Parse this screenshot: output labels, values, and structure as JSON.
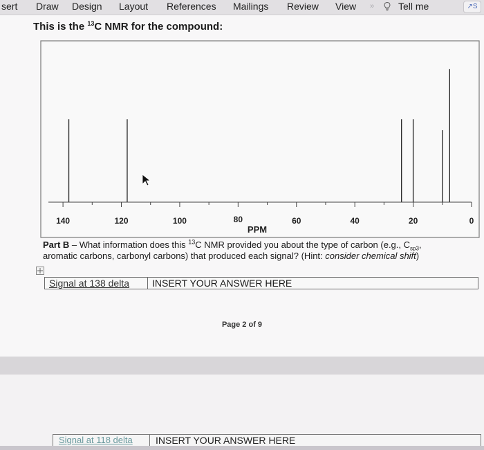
{
  "ribbon": {
    "tabs": [
      "sert",
      "Draw",
      "Design",
      "Layout",
      "References",
      "Mailings",
      "Review",
      "View"
    ],
    "tell_me": "Tell me",
    "more_symbol": "»",
    "share_label": "S"
  },
  "document": {
    "heading_pre": "This is the ",
    "heading_sup": "13",
    "heading_post": "C NMR for the compound:",
    "part_b": {
      "label": "Part B",
      "text_1": " – What information does this ",
      "sup": "13",
      "text_2": "C NMR provided you about the type of carbon (e.g., C",
      "sub": "sp3",
      "text_3": ",",
      "text_4": "aromatic carbons, carbonyl carbons) that produced each signal? (Hint: ",
      "hint": "consider chemical shift",
      "text_5": ")"
    },
    "answer_row_1": {
      "label": "Signal at 138 delta",
      "answer": "INSERT YOUR ANSWER HERE"
    },
    "page_number": "Page 2 of 9",
    "answer_row_2": {
      "label": "Signal at 118 delta",
      "answer": "INSERT YOUR ANSWER HERE"
    }
  },
  "colors": {
    "ribbon_bg": "#e2e0e3",
    "page_bg": "#f8f7f8",
    "peak_color": "#222222",
    "link_teal": "#6a9a9e"
  },
  "chart_data": {
    "type": "bar",
    "xlabel": "PPM",
    "xlim": [
      145,
      0
    ],
    "ylim": [
      0,
      1
    ],
    "x_ticks": [
      140,
      120,
      100,
      80,
      60,
      40,
      20,
      0
    ],
    "peaks": [
      {
        "ppm": 138,
        "height": 0.53
      },
      {
        "ppm": 118,
        "height": 0.53
      },
      {
        "ppm": 24,
        "height": 0.53
      },
      {
        "ppm": 20,
        "height": 0.53
      },
      {
        "ppm": 10,
        "height": 0.46
      },
      {
        "ppm": 7.5,
        "height": 0.85
      }
    ],
    "grid": false
  }
}
